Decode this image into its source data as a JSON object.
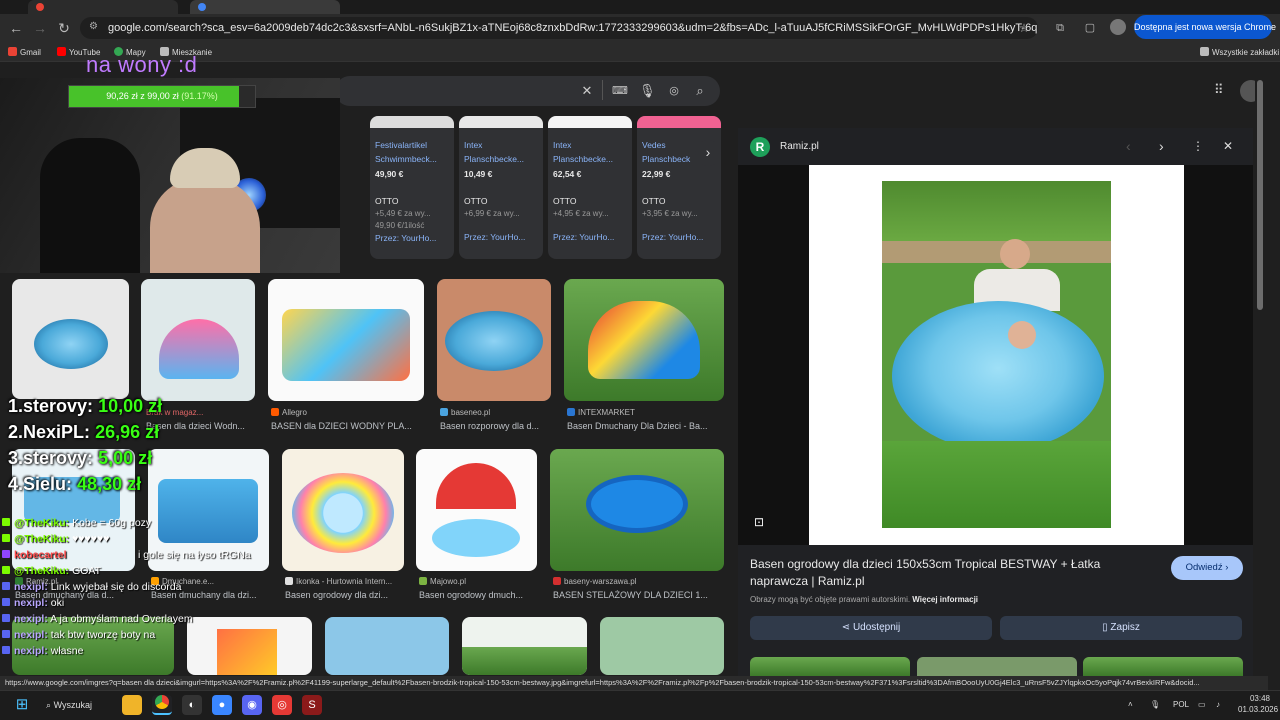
{
  "browser": {
    "url": "google.com/search?sca_esv=6a2009deb74dc2c3&sxsrf=ANbL-n6SukjBZ1x-aTNEoj68c8znxbDdRw:1772333299603&udm=2&fbs=ADc_l-aTuuAJ5fCRiMSSikFOrGF_MvHLWdPDPs1HkyT-6qmTCHFPEKAC86zldOH41Oq...",
    "update_button": "Dostępna jest nowa wersja Chrome",
    "bookmarks": [
      "Gmail",
      "YouTube",
      "Mapy",
      "Mieszkanie"
    ],
    "all_bookmarks": "Wszystkie zakładki",
    "status_url": "https://www.google.com/imgres?q=basen dla dzieci&imgurl=https%3A%2F%2Framiz.pl%2F41199-superlarge_default%2Fbasen-brodzik-tropical-150-53cm-bestway.jpg&imgrefurl=https%3A%2F%2Framiz.pl%2Fp%2Fbasen-brodzik-tropical-150-53cm-bestway%2F371%3Fsrsltid%3DAfmBOooUyU0Gj4Elc3_uRnsF5vZJYlqpkxOc5yoPqjk74vrBexkIRFw&docid..."
  },
  "products": [
    {
      "name1": "Festivalartikel",
      "name2": "Schwimmbeck...",
      "price": "49,90 €",
      "shop": "OTTO",
      "ship": "+5,49 € za wy...",
      "per": "49,90 €/1ilość",
      "by": "Przez: YourHo..."
    },
    {
      "name1": "Intex",
      "name2": "Planschbecke...",
      "price": "10,49 €",
      "shop": "OTTO",
      "ship": "+6,99 € za wy...",
      "per": "",
      "by": "Przez: YourHo..."
    },
    {
      "name1": "Intex",
      "name2": "Planschbecke...",
      "price": "62,54 €",
      "shop": "OTTO",
      "ship": "+4,95 € za wy...",
      "per": "",
      "by": "Przez: YourHo..."
    },
    {
      "name1": "Vedes",
      "name2": "Planschbeck",
      "price": "22,99 €",
      "shop": "OTTO",
      "ship": "+3,95 € za wy...",
      "per": "",
      "by": "Przez: YourHo..."
    }
  ],
  "partial_products": [
    {
      "price": "",
      "by": "o..."
    }
  ],
  "results_row1": [
    {
      "source": "",
      "badge": "Brak w magaz...",
      "title": "Basen dla dzieci Wodn..."
    },
    {
      "source": "Allegro",
      "title": "BASEN dla DZIECI WODNY PLA..."
    },
    {
      "source": "baseneo.pl",
      "title": "Basen rozporowy dla d..."
    },
    {
      "source": "INTEXMARKET",
      "title": "Basen Dmuchany Dla Dzieci - Ba..."
    }
  ],
  "results_row2": [
    {
      "source": "Ramiz.pl",
      "title": "Basen dmuchany dla d..."
    },
    {
      "source": "Dmuchane.e...",
      "title": "Basen dmuchany dla dzi..."
    },
    {
      "source": "Ikonka - Hurtownia Intern...",
      "title": "Basen ogrodowy dla dzi..."
    },
    {
      "source": "Majowo.pl",
      "title": "Basen ogrodowy dmuch..."
    },
    {
      "source": "baseny-warszawa.pl",
      "title": "BASEN STELAŻOWY DLA DZIECI 1..."
    }
  ],
  "panel": {
    "site": "Ramiz.pl",
    "title": "Basen ogrodowy dla dzieci 150x53cm Tropical BESTWAY + Łatka naprawcza | Ramiz.pl",
    "copyright": "Obrazy mogą być objęte prawami autorskimi.",
    "more_info": "Więcej informacji",
    "visit": "Odwiedź",
    "share": "Udostępnij",
    "save": "Zapisz"
  },
  "stream": {
    "goal_title": "na wony :d",
    "goal_amount": "90,26 zł z 99,00 zł",
    "goal_percent": "(91.17%)",
    "goal_fraction": 0.9117,
    "leaderboard": [
      {
        "rank": "1.",
        "name": "sterovy:",
        "amount": "10,00 zł"
      },
      {
        "rank": "2.",
        "name": "NexiPL:",
        "amount": "26,96 zł"
      },
      {
        "rank": "3.",
        "name": "sterovy:",
        "amount": "5,00 zł"
      },
      {
        "rank": "4.",
        "name": "Sielu:",
        "amount": "48,30 zł"
      }
    ],
    "chat": [
      {
        "user": "@TheKiku:",
        "text": " Kobe = 60g pozy",
        "color": "#7cfc00"
      },
      {
        "user": "@TheKiku:",
        "text": " ♥♥♥♥♥♥",
        "color": "#7cfc00"
      },
      {
        "user": "",
        "text": "i gole się na łyso tRGNa",
        "color": "#ffffff"
      },
      {
        "user": "kobecartel",
        "text": "",
        "color": "#ff4a4a"
      },
      {
        "user": "@TheKiku:",
        "text": " GOAT",
        "color": "#7cfc00"
      },
      {
        "user": "nexipl:",
        "text": " Link wyjebał się do discorda",
        "color": "#b9a7ff"
      },
      {
        "user": "nexipl:",
        "text": " oki",
        "color": "#b9a7ff"
      },
      {
        "user": "nexipl:",
        "text": " A ja obmyślam nad Overlayem",
        "color": "#b9a7ff"
      },
      {
        "user": "nexipl:",
        "text": " tak btw tworzę boty na",
        "color": "#b9a7ff"
      },
      {
        "user": "nexipl:",
        "text": " własne",
        "color": "#b9a7ff"
      }
    ]
  },
  "taskbar": {
    "search": "Wyszukaj",
    "lang": "POL",
    "time": "03:48",
    "date": "01.03.2026"
  }
}
